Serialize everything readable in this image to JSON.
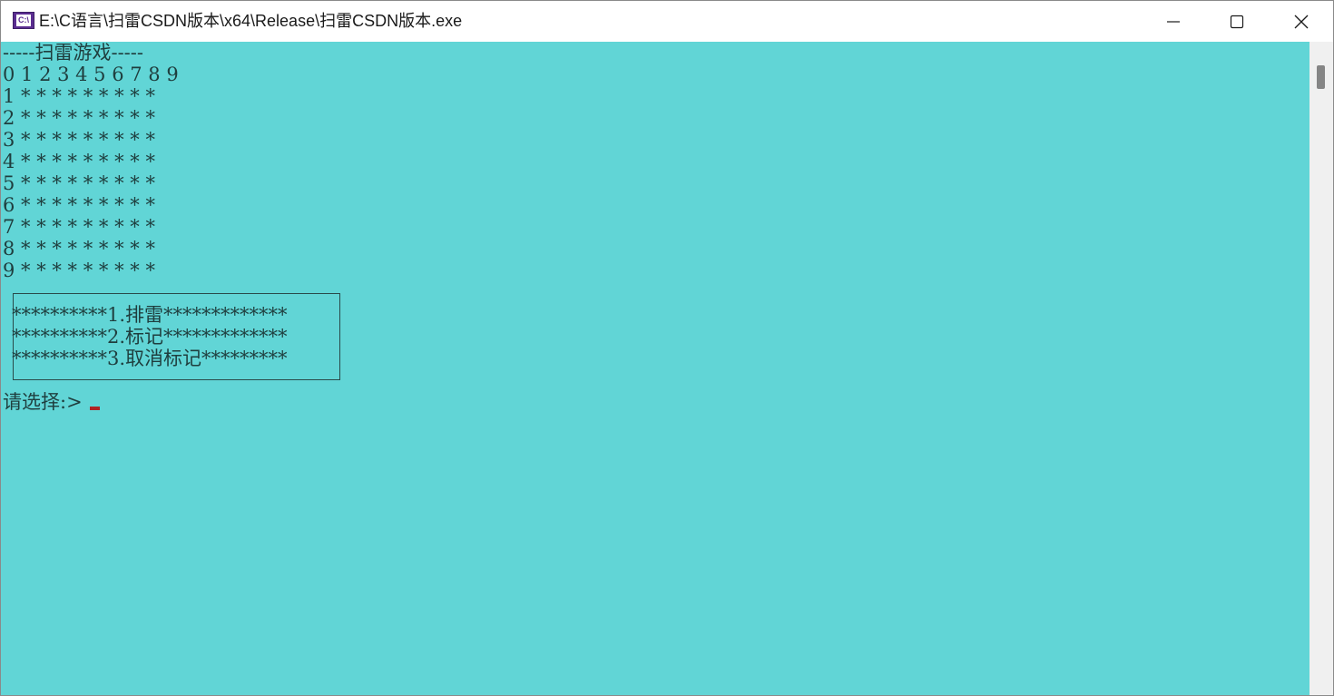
{
  "window": {
    "title": "E:\\C语言\\扫雷CSDN版本\\x64\\Release\\扫雷CSDN版本.exe",
    "icon_label": "C:\\",
    "icon": "console-app-icon",
    "caption_buttons": {
      "minimize_icon": "minimize-icon",
      "maximize_icon": "maximize-icon",
      "close_icon": "close-icon"
    }
  },
  "colors": {
    "console_background": "#61d5d6",
    "console_text": "#1f3e3e",
    "cursor": "#b02424",
    "title_text": "#1a1a1a",
    "icon_purple": "#5b2d91"
  },
  "console": {
    "header": "-----扫雷游戏-----",
    "board_rows": [
      "0 1 2 3 4 5 6 7 8 9",
      "1 * * * * * * * * *",
      "2 * * * * * * * * *",
      "3 * * * * * * * * *",
      "4 * * * * * * * * *",
      "5 * * * * * * * * *",
      "6 * * * * * * * * *",
      "7 * * * * * * * * *",
      "8 * * * * * * * * *",
      "9 * * * * * * * * *"
    ],
    "menu_items": [
      "**********1.排雷*************",
      "**********2.标记*************",
      "**********3.取消标记*********"
    ],
    "prompt": "请选择:>"
  }
}
